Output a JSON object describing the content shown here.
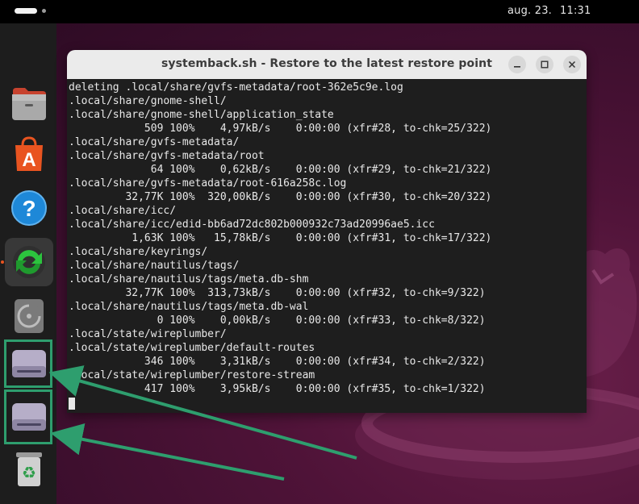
{
  "topbar": {
    "date": "aug. 23.",
    "time": "11:31"
  },
  "dock": {
    "items": [
      {
        "name": "files-icon"
      },
      {
        "name": "app-center-icon"
      },
      {
        "name": "help-icon"
      },
      {
        "name": "systemback-icon"
      },
      {
        "name": "optical-drive-icon"
      },
      {
        "name": "disk-drive-icon"
      },
      {
        "name": "disk-drive-icon"
      },
      {
        "name": "trash-icon"
      }
    ]
  },
  "window": {
    "title": "systemback.sh - Restore to the latest restore point",
    "terminal_lines": [
      "deleting .local/share/gvfs-metadata/root-362e5c9e.log",
      ".local/share/gnome-shell/",
      ".local/share/gnome-shell/application_state",
      "            509 100%    4,97kB/s    0:00:00 (xfr#28, to-chk=25/322)",
      ".local/share/gvfs-metadata/",
      ".local/share/gvfs-metadata/root",
      "             64 100%    0,62kB/s    0:00:00 (xfr#29, to-chk=21/322)",
      ".local/share/gvfs-metadata/root-616a258c.log",
      "         32,77K 100%  320,00kB/s    0:00:00 (xfr#30, to-chk=20/322)",
      ".local/share/icc/",
      ".local/share/icc/edid-bb6ad72dc802b000932c73ad20996ae5.icc",
      "          1,63K 100%   15,78kB/s    0:00:00 (xfr#31, to-chk=17/322)",
      ".local/share/keyrings/",
      ".local/share/nautilus/tags/",
      ".local/share/nautilus/tags/meta.db-shm",
      "         32,77K 100%  313,73kB/s    0:00:00 (xfr#32, to-chk=9/322)",
      ".local/share/nautilus/tags/meta.db-wal",
      "              0 100%    0,00kB/s    0:00:00 (xfr#33, to-chk=8/322)",
      ".local/state/wireplumber/",
      ".local/state/wireplumber/default-routes",
      "            346 100%    3,31kB/s    0:00:00 (xfr#34, to-chk=2/322)",
      ".local/state/wireplumber/restore-stream",
      "            417 100%    3,95kB/s    0:00:00 (xfr#35, to-chk=1/322)"
    ]
  },
  "colors": {
    "accent": "#e95420",
    "highlight": "#2e9e6e",
    "terminal_bg": "#1e1e1e"
  }
}
